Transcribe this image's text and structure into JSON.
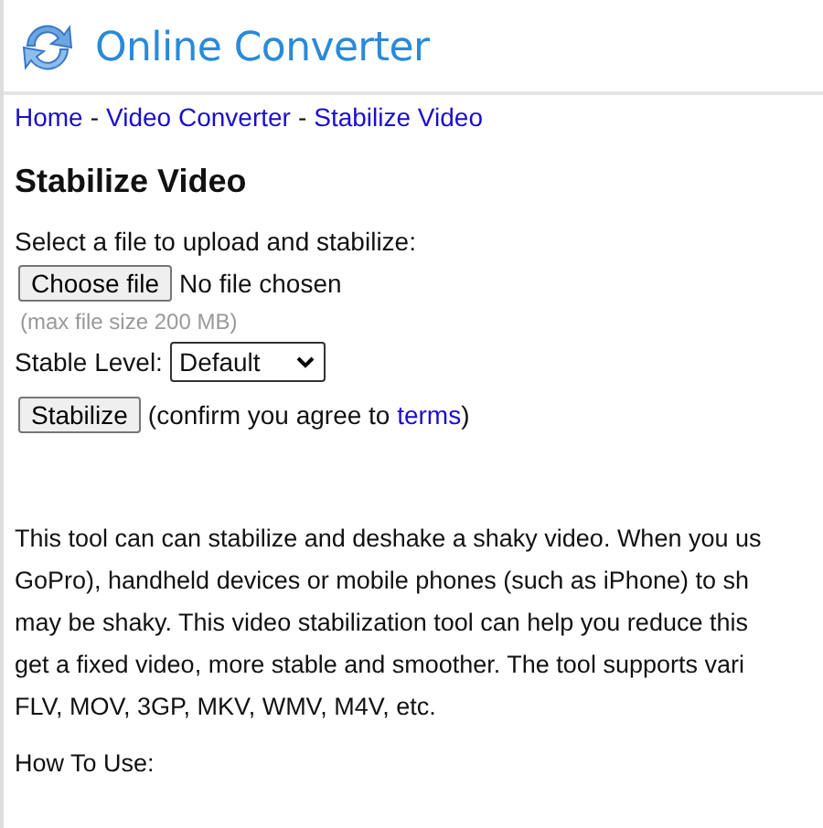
{
  "header": {
    "title": "Online Converter"
  },
  "breadcrumb": [
    {
      "label": "Home"
    },
    {
      "label": "Video Converter",
      "separator": "-"
    },
    {
      "label": "Stabilize Video",
      "separator": "-"
    }
  ],
  "heading": "Stabilize Video",
  "form": {
    "prompt": "Select a file to upload and stabilize:",
    "file_button": "Choose file",
    "file_status": "No file chosen",
    "hint": "(max file size 200 MB)",
    "level_label": "Stable Level:",
    "level_value": "Default",
    "submit": "Stabilize",
    "confirm_before": "(confirm you agree to ",
    "confirm_link": "terms",
    "confirm_after": ")"
  },
  "description_lines": [
    "This tool can can stabilize and deshake a shaky video. When you us",
    "GoPro), handheld devices or mobile phones (such as iPhone) to sh",
    "may be shaky. This video stabilization tool can help you reduce this",
    "get a fixed video, more stable and smoother. The tool supports vari",
    "FLV, MOV, 3GP, MKV, WMV, M4V, etc."
  ],
  "how_to_use": "How To Use:"
}
